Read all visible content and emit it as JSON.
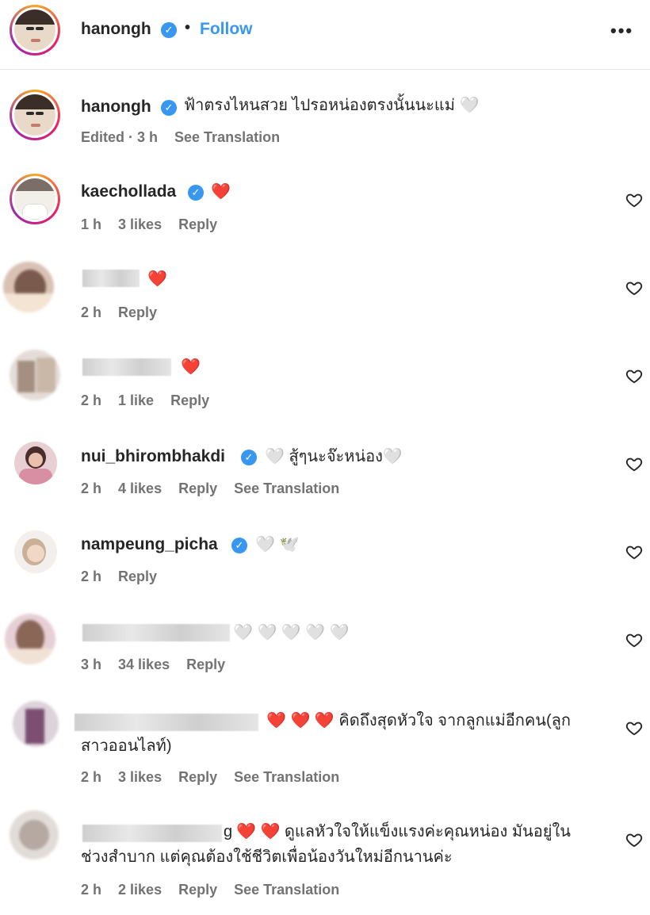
{
  "header": {
    "username": "hanongh",
    "separator": "•",
    "follow_label": "Follow",
    "more_label": "•••"
  },
  "caption": {
    "username": "hanongh",
    "text": "ฟ้าตรงไหนสวย ไปรอหน่องตรงนั้นนะแม่ 🤍",
    "edited": "Edited · 3 h",
    "see_translation": "See Translation"
  },
  "comments": [
    {
      "username": "kaechollada",
      "verified": true,
      "text": "❤️",
      "time": "1 h",
      "likes": "3 likes",
      "reply": "Reply"
    },
    {
      "username": "",
      "verified": false,
      "text": "❤️",
      "time": "2 h",
      "likes": "",
      "reply": "Reply"
    },
    {
      "username": "",
      "verified": false,
      "text": "❤️",
      "time": "2 h",
      "likes": "1 like",
      "reply": "Reply"
    },
    {
      "username": "nui_bhirombhakdi",
      "verified": true,
      "text": "🤍 สู้ๆนะจ๊ะหน่อง🤍",
      "time": "2 h",
      "likes": "4 likes",
      "reply": "Reply",
      "see_translation": "See Translation"
    },
    {
      "username": "nampeung_picha",
      "verified": true,
      "text": "🤍 🕊️",
      "time": "2 h",
      "likes": "",
      "reply": "Reply"
    },
    {
      "username": "",
      "verified": false,
      "text": "🤍 🤍 🤍 🤍 🤍",
      "time": "3 h",
      "likes": "34 likes",
      "reply": "Reply"
    },
    {
      "username": "",
      "verified": false,
      "text": "❤️ ❤️ ❤️ คิดถึงสุดหัวใจ จากลูกแม่อีกคน(ลูก",
      "text2": "สาวออนไลท์)",
      "time": "2 h",
      "likes": "3 likes",
      "reply": "Reply",
      "see_translation": "See Translation"
    },
    {
      "username": "g",
      "verified": false,
      "text": "❤️ ❤️ ดูแลหัวใจให้แข็งแรงค่ะคุณหน่อง มันอยู่ใน",
      "text2": "ช่วงสำบาก แต่คุณต้องใช้ชีวิตเพื่อน้องวันใหม่อีกนานค่ะ",
      "time": "2 h",
      "likes": "2 likes",
      "reply": "Reply",
      "see_translation": "See Translation"
    }
  ],
  "colors": {
    "link": "#3897f0",
    "meta": "#737373",
    "verified": "#3897f0"
  },
  "icons": {
    "verified": "verified-badge-icon",
    "like": "heart-outline-icon",
    "more": "more-options-icon"
  }
}
